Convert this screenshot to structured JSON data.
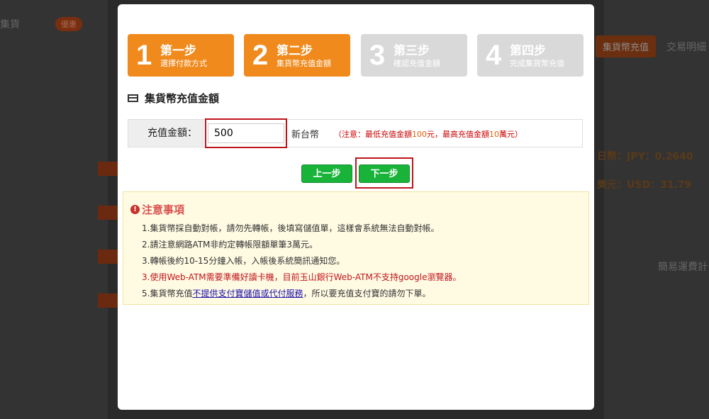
{
  "background": {
    "left_text_1": "集貨",
    "badge": "優惠",
    "right_btn_1": "集貨幣充值",
    "right_text_1": "交易明細",
    "rate_jpy": "日幣：JPY：0.2640",
    "rate_usd": "美元：USD：31.79",
    "right_text_2": "簡易運費計"
  },
  "steps": [
    {
      "num": "1",
      "title": "第一步",
      "sub": "選擇付款方式"
    },
    {
      "num": "2",
      "title": "第二步",
      "sub": "集貨幣充值金額"
    },
    {
      "num": "3",
      "title": "第三步",
      "sub": "確認充值金額"
    },
    {
      "num": "4",
      "title": "第四步",
      "sub": "完成集貨幣充值"
    }
  ],
  "section": {
    "title": "集貨幣充值金額"
  },
  "form": {
    "amount_label": "充值金額：",
    "amount_value": "500",
    "currency": "新台幣",
    "note_prefix": "（注意：最低充值金額",
    "note_min": "100",
    "note_mid": "元，最高充值金額",
    "note_max": "10",
    "note_suffix": "萬元）"
  },
  "buttons": {
    "prev": "上一步",
    "next": "下一步"
  },
  "notice": {
    "title": "注意事項",
    "items": [
      "1.集貨幣採自動對帳，請勿先轉帳，後填寫儲值單，這樣會系統無法自動對帳。",
      "2.請注意網路ATM非約定轉帳限額單筆3萬元。",
      "3.轉帳後約10-15分鐘入帳，入帳後系統簡訊通知您。",
      "3.使用Web-ATM需要準備好讀卡機，目前玉山銀行Web-ATM不支持google瀏覽器。"
    ],
    "item5_prefix": "5.集貨幣充值",
    "item5_link": "不提供支付寶儲值或代付服務",
    "item5_suffix": "，所以要充值支付寶的請勿下單。"
  },
  "colors": {
    "orange": "#f08a1c",
    "green": "#19b33a",
    "highlight": "#c0141c"
  }
}
